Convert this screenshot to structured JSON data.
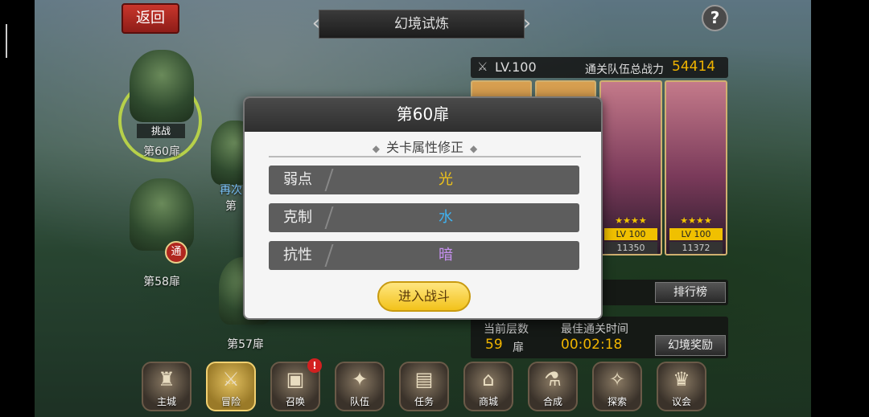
{
  "header": {
    "back_label": "返回",
    "title": "幻境试炼",
    "help_label": "?"
  },
  "map": {
    "nodes": [
      {
        "name": "第60扉",
        "tag": "挑战"
      },
      {
        "name": "第58扉",
        "badge": "通"
      },
      {
        "name": "第57扉"
      }
    ],
    "partial_labels": [
      "再次",
      "第"
    ]
  },
  "team": {
    "level": "LV.100",
    "power_label": "通关队伍总战力",
    "power_value": "54414",
    "cards": [
      {
        "level": "LV 100",
        "power": "11350"
      },
      {
        "level": "LV 100",
        "power": "11372"
      }
    ]
  },
  "stats": {
    "floor_label": "当前层数",
    "best_time_label": "最佳通关时间",
    "floor_value": "59",
    "floor_unit": "扉",
    "best_time_value": "00:02:18",
    "rank_button": "排行榜",
    "reward_button": "幻境奖励"
  },
  "modal": {
    "title": "第60扉",
    "section_title": "关卡属性修正",
    "rows": [
      {
        "key": "弱点",
        "value": "光",
        "color": "#f0c419"
      },
      {
        "key": "克制",
        "value": "水",
        "color": "#3fb2f0"
      },
      {
        "key": "抗性",
        "value": "暗",
        "color": "#c690f0"
      }
    ],
    "enter_button": "进入战斗"
  },
  "bottom_nav": [
    {
      "label": "主城",
      "icon": "castle-icon"
    },
    {
      "label": "冒险",
      "icon": "crossed-swords-icon",
      "active": true
    },
    {
      "label": "召唤",
      "icon": "summon-card-icon",
      "badge": "!"
    },
    {
      "label": "队伍",
      "icon": "team-crest-icon"
    },
    {
      "label": "任务",
      "icon": "quest-book-icon"
    },
    {
      "label": "商城",
      "icon": "shop-icon"
    },
    {
      "label": "合成",
      "icon": "potion-icon"
    },
    {
      "label": "探索",
      "icon": "compass-icon"
    },
    {
      "label": "议会",
      "icon": "council-icon"
    }
  ]
}
